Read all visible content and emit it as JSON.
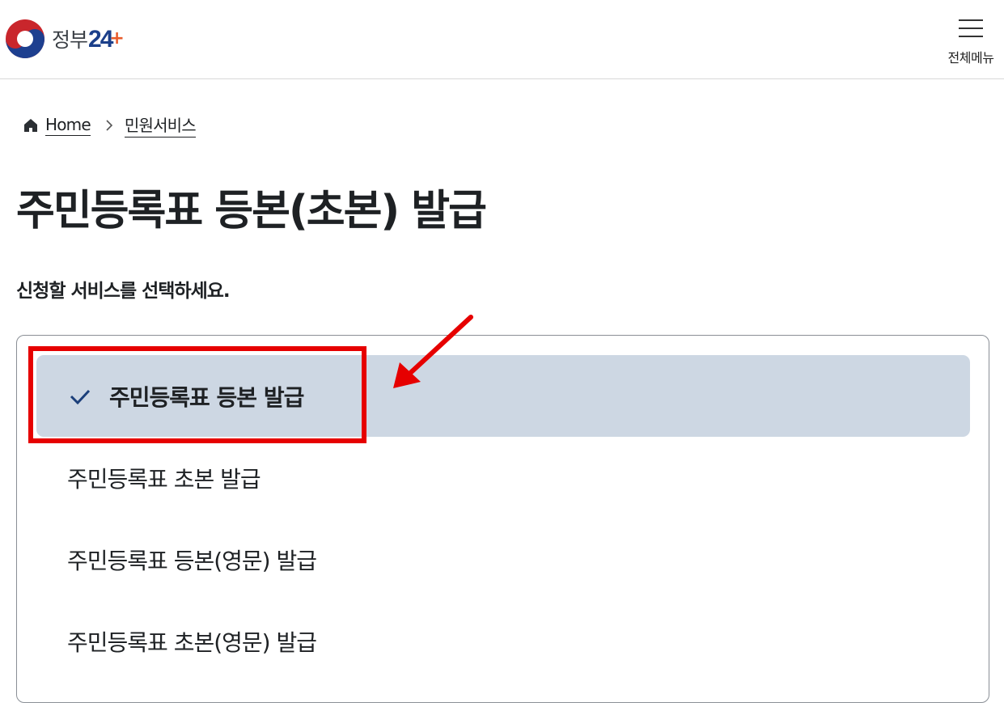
{
  "header": {
    "logo_text": "정부",
    "logo_num": "24",
    "logo_plus": "+",
    "menu_label": "전체메뉴"
  },
  "breadcrumb": {
    "home": "Home",
    "current": "민원서비스"
  },
  "page": {
    "title": "주민등록표 등본(초본) 발급",
    "subtitle": "신청할 서비스를 선택하세요."
  },
  "options": [
    {
      "label": "주민등록표 등본 발급",
      "selected": true
    },
    {
      "label": "주민등록표 초본 발급",
      "selected": false
    },
    {
      "label": "주민등록표 등본(영문) 발급",
      "selected": false
    },
    {
      "label": "주민등록표 초본(영문) 발급",
      "selected": false
    }
  ],
  "colors": {
    "selected_bg": "#cdd7e3",
    "check": "#1b3f7a",
    "annotation_red": "#e60000"
  },
  "icons": {
    "logo": "taegeuk-logo-icon",
    "menu": "hamburger-menu-icon",
    "home": "home-icon",
    "separator": "chevron-right-icon",
    "check": "check-icon",
    "annotation": "red-arrow-icon"
  }
}
